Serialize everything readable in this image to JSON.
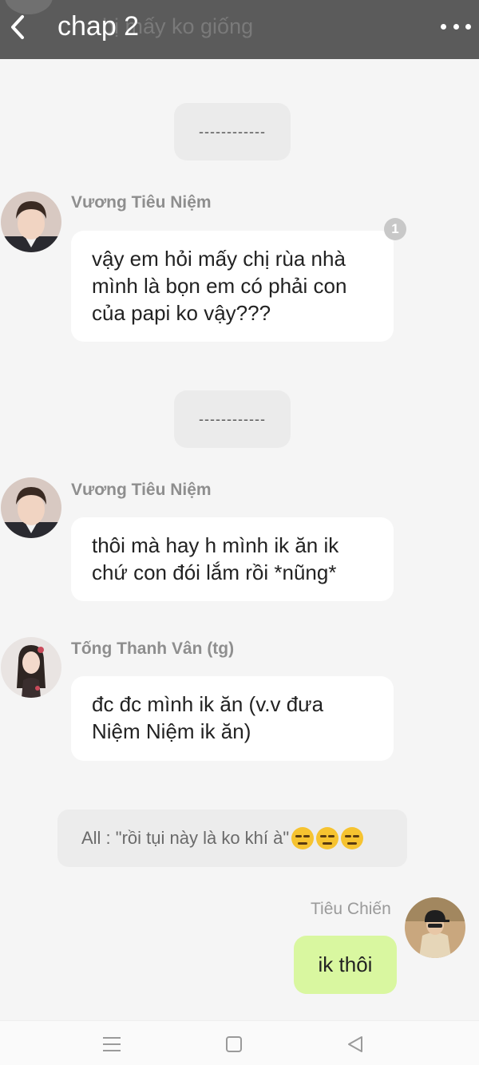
{
  "header": {
    "title": "chap 2",
    "ghost_text": "bị mấy ko giống"
  },
  "messages": [
    {
      "type": "divider",
      "text": "------------"
    },
    {
      "type": "text",
      "sender": "Vương Tiêu Niệm",
      "lines": [
        "vậy em hỏi mấy chị rùa nhà",
        "mình là bọn em có phải con",
        "của papi ko vậy???"
      ],
      "badge": "1"
    },
    {
      "type": "divider",
      "text": "------------"
    },
    {
      "type": "text",
      "sender": "Vương Tiêu Niệm",
      "lines": [
        "thôi mà hay h mình ik ăn ik",
        "chứ con đói lắm rồi *nũng*"
      ]
    },
    {
      "type": "text",
      "sender": "Tống Thanh Vân (tg)",
      "lines": [
        "đc đc mình ik ăn (v.v đưa",
        "Niệm Niệm ik ăn)"
      ]
    },
    {
      "type": "system",
      "text": "All : \"rồi tụi này là ko khí à\""
    },
    {
      "type": "outgoing",
      "sender": "Tiêu Chiến",
      "text": "ik thôi"
    }
  ],
  "icons": {
    "back": "chevron-left-icon",
    "more": "more-dots-icon",
    "emoji": "expressionless-face-emoji",
    "nav": [
      "menu-icon",
      "home-square-icon",
      "back-triangle-icon"
    ]
  },
  "colors": {
    "header_bg": "#5b5b5b",
    "outgoing_bubble": "#d9f7a0",
    "page_bg": "#f5f5f5"
  }
}
